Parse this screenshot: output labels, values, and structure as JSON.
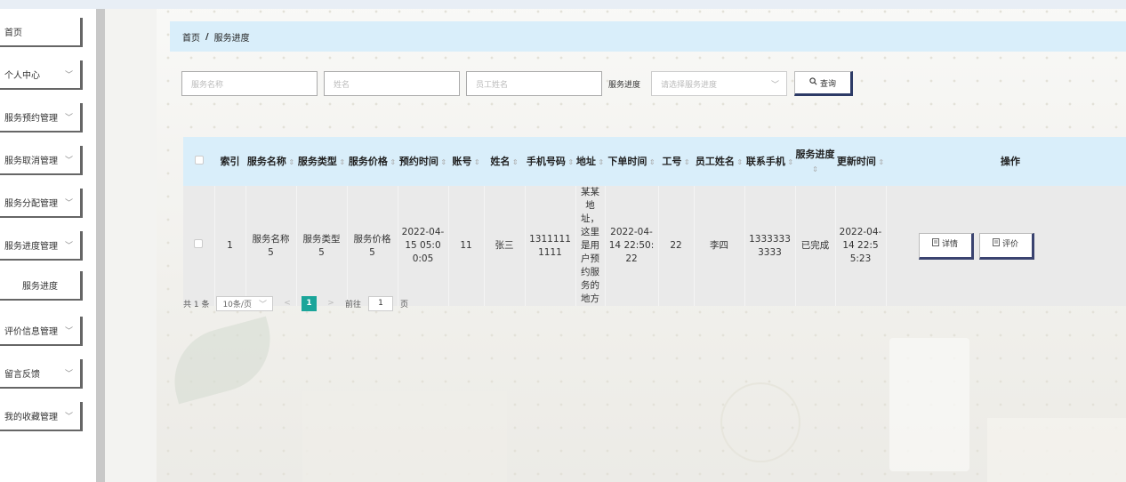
{
  "sidebar": {
    "items": [
      {
        "label": "首页",
        "chevron": false
      },
      {
        "label": "个人中心",
        "chevron": true
      },
      {
        "label": "服务预约管理",
        "chevron": true
      },
      {
        "label": "服务取消管理",
        "chevron": true
      },
      {
        "label": "服务分配管理",
        "chevron": true
      },
      {
        "label": "服务进度管理",
        "chevron": true
      },
      {
        "label": "服务进度",
        "chevron": false,
        "sub": true
      },
      {
        "label": "评价信息管理",
        "chevron": true
      },
      {
        "label": "留言反馈",
        "chevron": true
      },
      {
        "label": "我的收藏管理",
        "chevron": true
      }
    ],
    "chevron_glyph": "﹀"
  },
  "breadcrumb": {
    "home": "首页",
    "separator": "/",
    "current": "服务进度"
  },
  "search": {
    "service_name_placeholder": "服务名称",
    "name_placeholder": "姓名",
    "employee_name_placeholder": "员工姓名",
    "progress_label": "服务进度",
    "progress_placeholder": "请选择服务进度",
    "query_button": "查询"
  },
  "table": {
    "headers": [
      {
        "text": "",
        "sortable": false
      },
      {
        "text": "索引",
        "sortable": false
      },
      {
        "text": "服务名称",
        "sortable": true
      },
      {
        "text": "服务类型",
        "sortable": true
      },
      {
        "text": "服务价格",
        "sortable": true
      },
      {
        "text": "预约时间",
        "sortable": true
      },
      {
        "text": "账号",
        "sortable": true
      },
      {
        "text": "姓名",
        "sortable": true
      },
      {
        "text": "手机号码",
        "sortable": true
      },
      {
        "text": "地址",
        "sortable": true
      },
      {
        "text": "下单时间",
        "sortable": true
      },
      {
        "text": "工号",
        "sortable": true
      },
      {
        "text": "员工姓名",
        "sortable": true
      },
      {
        "text": "联系手机",
        "sortable": true
      },
      {
        "text": "服务进度",
        "sortable": true
      },
      {
        "text": "更新时间",
        "sortable": true
      },
      {
        "text": "操作",
        "sortable": false
      }
    ],
    "rows": [
      {
        "index": "1",
        "service_name": "服务名称5",
        "service_type": "服务类型5",
        "service_price": "服务价格5",
        "appointment_time": "2022-04-15 05:00:05",
        "account": "11",
        "name": "张三",
        "phone": "13111111111",
        "address": "某某地址，这里是用户预约服务的地方",
        "order_time": "2022-04-14 22:50:22",
        "employee_no": "22",
        "employee_name": "李四",
        "contact_phone": "13333333333",
        "progress": "已完成",
        "update_time": "2022-04-14 22:55:23",
        "actions": [
          "详情",
          "评价"
        ]
      }
    ]
  },
  "pagination": {
    "total_text": "共 1 条",
    "page_size": "10条/页",
    "current_page": "1",
    "goto_label": "前往",
    "goto_value": "1",
    "page_unit": "页"
  },
  "colors": {
    "accent": "#1aa59a",
    "header_bg": "#d9eefa",
    "button_shadow": "#2c3a66"
  }
}
